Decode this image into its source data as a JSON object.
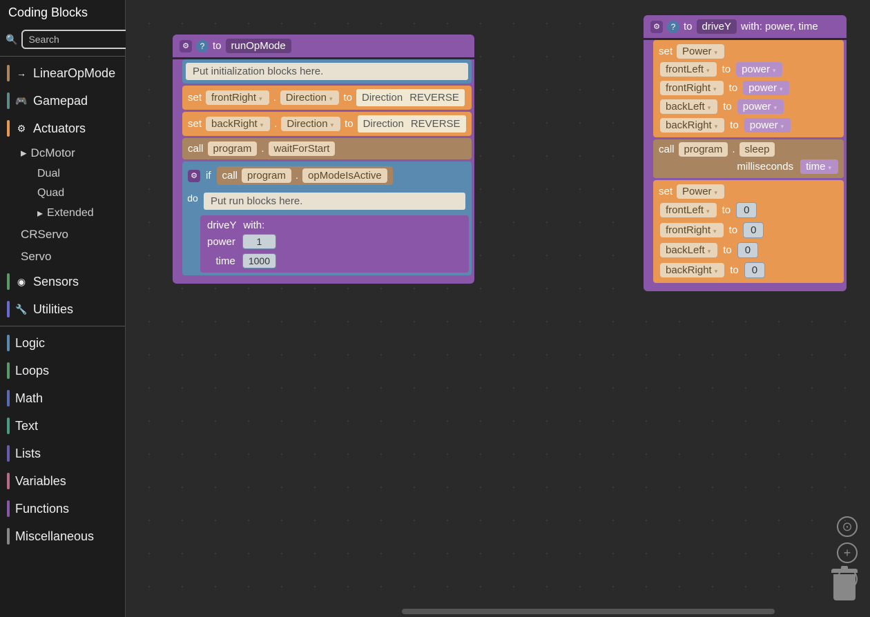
{
  "sidebar": {
    "title": "Coding Blocks",
    "search_placeholder": "Search",
    "categories": [
      {
        "label": "LinearOpMode",
        "color": "#a88560",
        "icon": "→"
      },
      {
        "label": "Gamepad",
        "color": "#608a88",
        "icon": "🎮"
      },
      {
        "label": "Actuators",
        "color": "#e89850",
        "icon": "⚙"
      },
      {
        "label": "Sensors",
        "color": "#5a9a68",
        "icon": "◉"
      },
      {
        "label": "Utilities",
        "color": "#6a6ad0",
        "icon": "🔧"
      }
    ],
    "actuator_sub": [
      {
        "label": "DcMotor",
        "expandable": true
      },
      {
        "label": "CRServo",
        "expandable": false
      },
      {
        "label": "Servo",
        "expandable": false
      }
    ],
    "dcmotor_sub": [
      "Dual",
      "Quad",
      "Extended"
    ],
    "categories2": [
      {
        "label": "Logic",
        "color": "#5a8ab0"
      },
      {
        "label": "Loops",
        "color": "#5a9a68"
      },
      {
        "label": "Math",
        "color": "#5a6ab0"
      },
      {
        "label": "Text",
        "color": "#4a9a88"
      },
      {
        "label": "Lists",
        "color": "#6a5ab0"
      },
      {
        "label": "Variables",
        "color": "#b86a88"
      },
      {
        "label": "Functions",
        "color": "#8a57a8"
      },
      {
        "label": "Miscellaneous",
        "color": "#888"
      }
    ]
  },
  "runop": {
    "keyword_to": "to",
    "name": "runOpMode",
    "comment1": "Put initialization blocks here.",
    "set_kw": "set",
    "dot": ".",
    "to_kw": "to",
    "direction": "Direction",
    "reverse": "REVERSE",
    "motor_fr": "frontRight",
    "motor_br": "backRight",
    "call": "call",
    "program": "program",
    "waitForStart": "waitForStart",
    "if": "if",
    "do": "do",
    "opModeIsActive": "opModeIsActive",
    "comment2": "Put run blocks here.",
    "driveY": "driveY",
    "with": "with:",
    "power_label": "power",
    "time_label": "time",
    "power_val": "1",
    "time_val": "1000"
  },
  "driveY": {
    "keyword_to": "to",
    "name": "driveY",
    "with_params": "with: power, time",
    "set_kw": "set",
    "Power": "Power",
    "to_kw": "to",
    "frontLeft": "frontLeft",
    "frontRight": "frontRight",
    "backLeft": "backLeft",
    "backRight": "backRight",
    "power_var": "power",
    "call": "call",
    "program": "program",
    "dot": ".",
    "sleep": "sleep",
    "milliseconds": "milliseconds",
    "time_var": "time",
    "zero": "0"
  }
}
